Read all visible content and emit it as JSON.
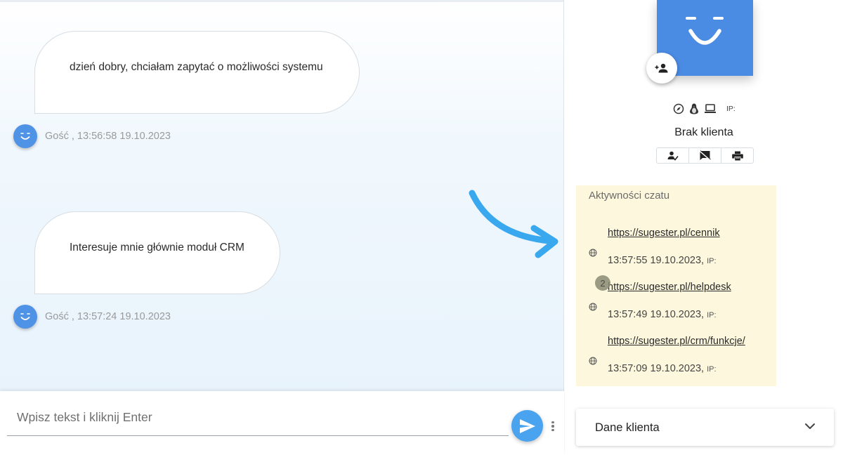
{
  "chat": {
    "messages": [
      {
        "text": "dzień dobry, chciałam zapytać o możliwości systemu",
        "meta": "Gość , 13:56:58 19.10.2023"
      },
      {
        "text": "Interesuje mnie głównie moduł CRM",
        "meta": "Gość , 13:57:24 19.10.2023"
      }
    ],
    "input_placeholder": "Wpisz tekst i kliknij Enter"
  },
  "client": {
    "ip_label": "IP:",
    "name": "Brak klienta",
    "device_icons": [
      "compass-icon",
      "linux-penguin-icon",
      "laptop-icon"
    ],
    "actions": [
      "assign-person-icon",
      "close-chat-icon",
      "print-icon"
    ]
  },
  "activity": {
    "title": "Aktywności czatu",
    "visit_count": "2",
    "items": [
      {
        "url": "https://sugester.pl/cennik",
        "time": "13:57:55 19.10.2023,",
        "ip": "IP:"
      },
      {
        "url": "https://sugester.pl/helpdesk",
        "time": "13:57:49 19.10.2023,",
        "ip": "IP:"
      },
      {
        "url": "https://sugester.pl/crm/funkcje/",
        "time": "13:57:09 19.10.2023,",
        "ip": "IP:"
      }
    ]
  },
  "client_data": {
    "title": "Dane klienta"
  },
  "colors": {
    "accent_blue": "#4a8be3",
    "send_blue": "#4aa3ef",
    "arrow_blue": "#3aa8ee",
    "activity_bg": "#fdf8dd"
  }
}
